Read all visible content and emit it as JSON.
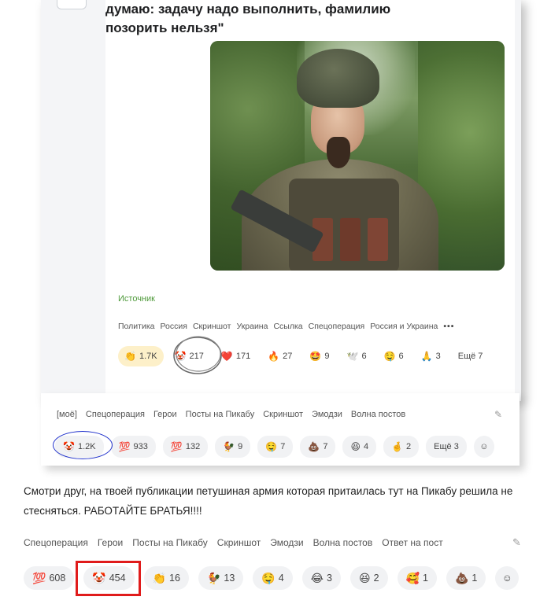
{
  "post": {
    "quote_line1": "думаю: задачу надо выполнить, фамилию",
    "quote_line2": "позорить нельзя\"",
    "source_label": "Источник",
    "tags": [
      "Политика",
      "Россия",
      "Скриншот",
      "Украина",
      "Ссылка",
      "Спецоперация",
      "Россия и Украина"
    ],
    "more_icon": "ellipsis-icon",
    "reactions": [
      {
        "emoji": "👏",
        "count": "1.7K",
        "active": true
      },
      {
        "emoji": "🤡",
        "count": "217"
      },
      {
        "emoji": "❤️",
        "count": "171"
      },
      {
        "emoji": "🔥",
        "count": "27"
      },
      {
        "emoji": "🤩",
        "count": "9"
      },
      {
        "emoji": "🕊️",
        "count": "6"
      },
      {
        "emoji": "🤤",
        "count": "6"
      },
      {
        "emoji": "🙏",
        "count": "3"
      }
    ],
    "more_reactions": "Ещё 7"
  },
  "comment1": {
    "tags": [
      "[моё]",
      "Спецоперация",
      "Герои",
      "Посты на Пикабу",
      "Скриншот",
      "Эмодзи",
      "Волна постов"
    ],
    "reactions": [
      {
        "emoji": "🤡",
        "count": "1.2K"
      },
      {
        "emoji": "💯",
        "count": "933",
        "alt": "500"
      },
      {
        "emoji": "💯",
        "count": "132"
      },
      {
        "emoji": "🐓",
        "count": "9"
      },
      {
        "emoji": "🤤",
        "count": "7"
      },
      {
        "emoji": "💩",
        "count": "7"
      },
      {
        "emoji": "😆",
        "count": "4"
      },
      {
        "emoji": "🤞",
        "count": "2"
      }
    ],
    "more_reactions": "Ещё 3"
  },
  "comment2": {
    "text": "Смотри друг, на твоей публикации петушиная армия которая притаилась тут на Пикабу решила не стесняться. РАБОТАЙТЕ БРАТЬЯ!!!!",
    "tags": [
      "Спецоперация",
      "Герои",
      "Посты на Пикабу",
      "Скриншот",
      "Эмодзи",
      "Волна постов",
      "Ответ на пост"
    ],
    "reactions": [
      {
        "emoji": "💯",
        "count": "608"
      },
      {
        "emoji": "🤡",
        "count": "454"
      },
      {
        "emoji": "👏",
        "count": "16"
      },
      {
        "emoji": "🐓",
        "count": "13"
      },
      {
        "emoji": "🤤",
        "count": "4"
      },
      {
        "emoji": "😂",
        "count": "3"
      },
      {
        "emoji": "😆",
        "count": "2"
      },
      {
        "emoji": "🥰",
        "count": "1"
      },
      {
        "emoji": "💩",
        "count": "1"
      }
    ]
  },
  "colors": {
    "source_link": "#4e9a3a",
    "active_chip": "#fdf0c9",
    "annotation_red": "#e01b1b",
    "annotation_blue": "#2233cc"
  }
}
